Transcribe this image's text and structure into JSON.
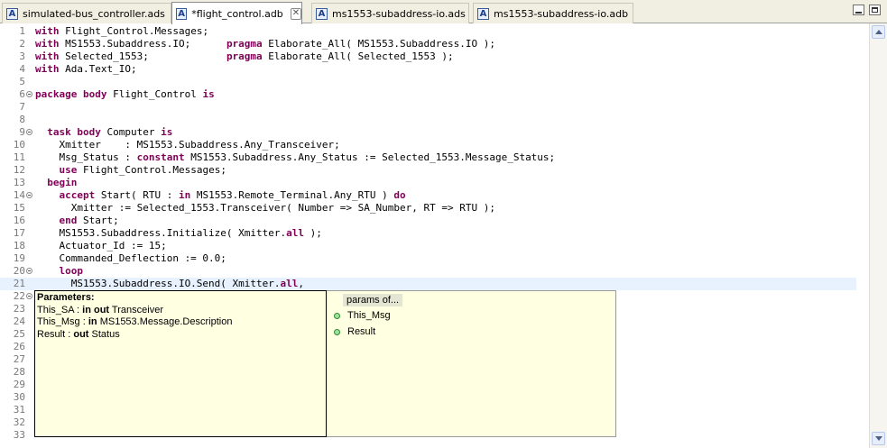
{
  "tabs": [
    {
      "label": "simulated-bus_controller.ads",
      "active": false
    },
    {
      "label": "*flight_control.adb",
      "active": true,
      "close": "✕"
    },
    {
      "label": "ms1553-subaddress-io.ads",
      "active": false
    },
    {
      "label": "ms1553-subaddress-io.adb",
      "active": false
    }
  ],
  "tab_icon_letter": "A",
  "editor": {
    "current_line": 21,
    "lines": [
      {
        "n": "1",
        "fold": false,
        "s": [
          {
            "k": "with"
          },
          {
            "t": " Flight_Control.Messages;"
          }
        ]
      },
      {
        "n": "2",
        "fold": false,
        "s": [
          {
            "k": "with"
          },
          {
            "t": " MS1553.Subaddress.IO;      "
          },
          {
            "k": "pragma"
          },
          {
            "t": " Elaborate_All( MS1553.Subaddress.IO );"
          }
        ]
      },
      {
        "n": "3",
        "fold": false,
        "s": [
          {
            "k": "with"
          },
          {
            "t": " Selected_1553;             "
          },
          {
            "k": "pragma"
          },
          {
            "t": " Elaborate_All( Selected_1553 );"
          }
        ]
      },
      {
        "n": "4",
        "fold": false,
        "s": [
          {
            "k": "with"
          },
          {
            "t": " Ada.Text_IO;"
          }
        ]
      },
      {
        "n": "5",
        "fold": false,
        "s": []
      },
      {
        "n": "6",
        "fold": true,
        "s": [
          {
            "k": "package body"
          },
          {
            "t": " Flight_Control "
          },
          {
            "k": "is"
          }
        ]
      },
      {
        "n": "7",
        "fold": false,
        "s": []
      },
      {
        "n": "8",
        "fold": false,
        "s": []
      },
      {
        "n": "9",
        "fold": true,
        "s": [
          {
            "t": "  "
          },
          {
            "k": "task body"
          },
          {
            "t": " Computer "
          },
          {
            "k": "is"
          }
        ]
      },
      {
        "n": "10",
        "fold": false,
        "s": [
          {
            "t": "    Xmitter    : MS1553.Subaddress.Any_Transceiver;"
          }
        ]
      },
      {
        "n": "11",
        "fold": false,
        "s": [
          {
            "t": "    Msg_Status : "
          },
          {
            "k": "constant"
          },
          {
            "t": " MS1553.Subaddress.Any_Status := Selected_1553.Message_Status;"
          }
        ]
      },
      {
        "n": "12",
        "fold": false,
        "s": [
          {
            "t": "    "
          },
          {
            "k": "use"
          },
          {
            "t": " Flight_Control.Messages;"
          }
        ]
      },
      {
        "n": "13",
        "fold": false,
        "s": [
          {
            "t": "  "
          },
          {
            "k": "begin"
          }
        ]
      },
      {
        "n": "14",
        "fold": true,
        "s": [
          {
            "t": "    "
          },
          {
            "k": "accept"
          },
          {
            "t": " Start( RTU : "
          },
          {
            "k": "in"
          },
          {
            "t": " MS1553.Remote_Terminal.Any_RTU ) "
          },
          {
            "k": "do"
          }
        ]
      },
      {
        "n": "15",
        "fold": false,
        "s": [
          {
            "t": "      Xmitter := Selected_1553.Transceiver( Number => SA_Number, RT => RTU );"
          }
        ]
      },
      {
        "n": "16",
        "fold": false,
        "s": [
          {
            "t": "    "
          },
          {
            "k": "end"
          },
          {
            "t": " Start;"
          }
        ]
      },
      {
        "n": "17",
        "fold": false,
        "s": [
          {
            "t": "    MS1553.Subaddress.Initialize( Xmitter."
          },
          {
            "k": "all"
          },
          {
            "t": " );"
          }
        ]
      },
      {
        "n": "18",
        "fold": false,
        "s": [
          {
            "t": "    Actuator_Id := 15;"
          }
        ]
      },
      {
        "n": "19",
        "fold": false,
        "s": [
          {
            "t": "    Commanded_Deflection := 0.0;"
          }
        ]
      },
      {
        "n": "20",
        "fold": true,
        "s": [
          {
            "t": "    "
          },
          {
            "k": "loop"
          }
        ]
      },
      {
        "n": "21",
        "fold": false,
        "s": [
          {
            "t": "      MS1553.Subaddress.IO.Send( Xmitter."
          },
          {
            "k": "all"
          },
          {
            "t": ","
          }
        ]
      },
      {
        "n": "22",
        "fold": true,
        "s": []
      },
      {
        "n": "23",
        "fold": false,
        "s": []
      },
      {
        "n": "24",
        "fold": false,
        "s": []
      },
      {
        "n": "25",
        "fold": false,
        "s": []
      },
      {
        "n": "26",
        "fold": false,
        "s": []
      },
      {
        "n": "27",
        "fold": false,
        "s": []
      },
      {
        "n": "28",
        "fold": false,
        "s": []
      },
      {
        "n": "29",
        "fold": false,
        "s": []
      },
      {
        "n": "30",
        "fold": false,
        "s": []
      },
      {
        "n": "31",
        "fold": false,
        "s": []
      },
      {
        "n": "32",
        "fold": false,
        "s": []
      },
      {
        "n": "33",
        "fold": false,
        "s": []
      }
    ]
  },
  "param_popup": {
    "header": "Parameters:",
    "params": [
      {
        "name": "This_SA : ",
        "mode": "in out",
        "type": " Transceiver"
      },
      {
        "name": "This_Msg : ",
        "mode": "in",
        "type": " MS1553.Message.Description"
      },
      {
        "name": "Result : ",
        "mode": "out",
        "type": " Status"
      }
    ]
  },
  "completion_popup": {
    "header": "params of...",
    "items": [
      "This_Msg",
      "Result"
    ]
  },
  "colors": {
    "keyword": "#7f0055",
    "current_line": "#e8f2fe",
    "popup_bg": "#ffffe1"
  }
}
